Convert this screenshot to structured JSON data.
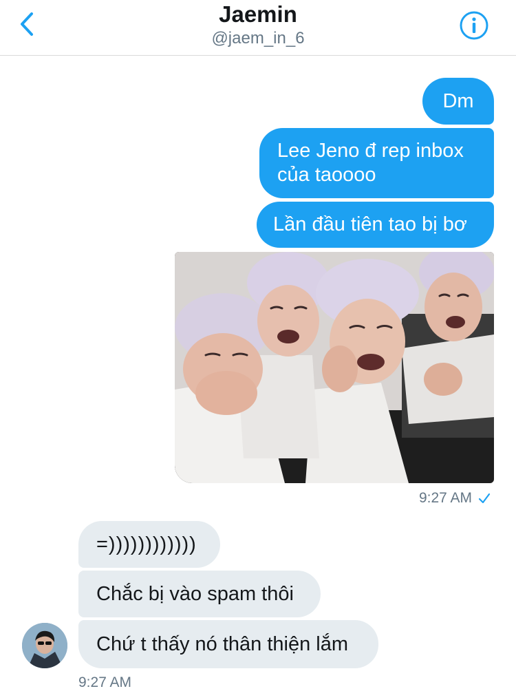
{
  "header": {
    "title": "Jaemin",
    "handle": "@jaem_in_6",
    "back_icon": "chevron-left-icon",
    "info_icon": "info-circle-icon",
    "accent_color": "#1da1f2"
  },
  "messages_sent": [
    {
      "text": "Dm"
    },
    {
      "text": "Lee Jeno đ rep inbox của taoooo"
    },
    {
      "text": "Lần đầu tiên tao bị bơ"
    }
  ],
  "sent_photo": {
    "description_icon": "meme-photo"
  },
  "sent_meta": {
    "time": "9:27 AM",
    "status_icon": "checkmark-icon"
  },
  "messages_received": [
    {
      "text": "=))))))))))))"
    },
    {
      "text": "Chắc bị vào spam thôi"
    },
    {
      "text": "Chứ t thấy nó thân thiện lắm"
    }
  ],
  "received_meta": {
    "time": "9:27 AM"
  },
  "colors": {
    "outgoing_bubble": "#1da1f2",
    "incoming_bubble": "#e6ecf0",
    "timestamp": "#657786"
  }
}
